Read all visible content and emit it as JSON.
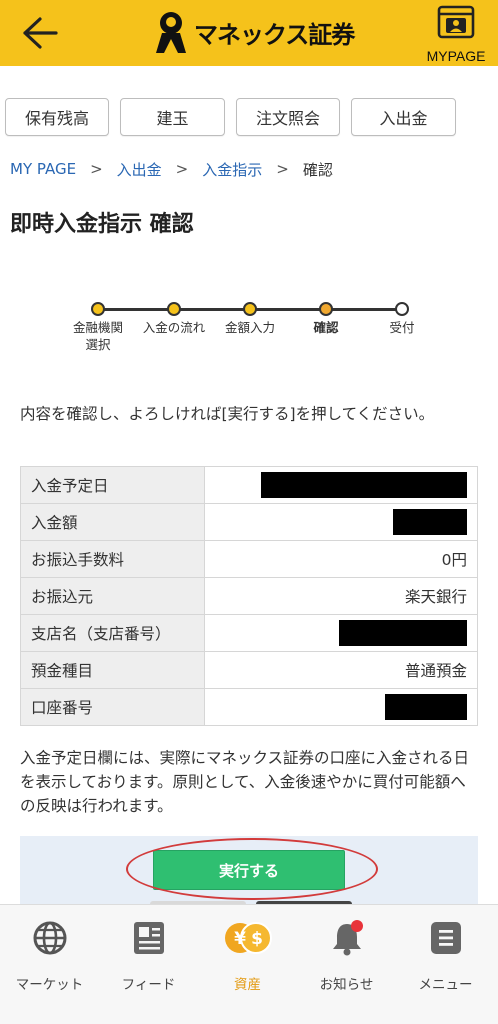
{
  "header": {
    "logo_text": "マネックス証券",
    "mypage_label": "MYPAGE"
  },
  "tabs": [
    {
      "label": "保有残高"
    },
    {
      "label": "建玉"
    },
    {
      "label": "注文照会"
    },
    {
      "label": "入出金"
    }
  ],
  "breadcrumb": {
    "items": [
      "MY PAGE",
      "入出金",
      "入金指示"
    ],
    "current": "確認",
    "separator": ">"
  },
  "page_title": "即時入金指示 確認",
  "stepper": {
    "steps": [
      {
        "label": "金融機関\n選択",
        "state": "done"
      },
      {
        "label": "入金の流れ",
        "state": "done"
      },
      {
        "label": "金額入力",
        "state": "done"
      },
      {
        "label": "確認",
        "state": "current"
      },
      {
        "label": "受付",
        "state": "todo"
      }
    ],
    "done_color": "#f5c21b",
    "current_color": "#f0a830"
  },
  "intro_text": "内容を確認し、よろしければ[実行する]を押してください。",
  "details": {
    "rows": [
      {
        "key": "入金予定日",
        "value": "",
        "redacted": true
      },
      {
        "key": "入金額",
        "value": "",
        "redacted": true
      },
      {
        "key": "お振込手数料",
        "value": "0円",
        "redacted": false
      },
      {
        "key": "お振込元",
        "value": "楽天銀行",
        "redacted": false
      },
      {
        "key": "支店名（支店番号）",
        "value": "",
        "redacted": true
      },
      {
        "key": "預金種目",
        "value": "普通預金",
        "redacted": false
      },
      {
        "key": "口座番号",
        "value": "",
        "redacted": true
      }
    ]
  },
  "note_text": "入金予定日欄には、実際にマネックス証券の口座に入金される日を表示しております。原則として、入金後速やかに買付可能額への反映は行われます。",
  "actions": {
    "execute_label": "実行する",
    "execute_color": "#2fbf71",
    "highlight_color": "#d23b3b"
  },
  "bottom_nav": {
    "items": [
      {
        "label": "マーケット",
        "icon": "globe-icon",
        "active": false
      },
      {
        "label": "フィード",
        "icon": "newspaper-icon",
        "active": false
      },
      {
        "label": "資産",
        "icon": "yen-dollar-coins-icon",
        "active": true
      },
      {
        "label": "お知らせ",
        "icon": "bell-icon",
        "active": false
      },
      {
        "label": "メニュー",
        "icon": "menu-icon",
        "active": false
      }
    ],
    "active_color": "#e39a10"
  },
  "colors": {
    "header_bg": "#f5c21b",
    "link": "#2a67b3"
  }
}
